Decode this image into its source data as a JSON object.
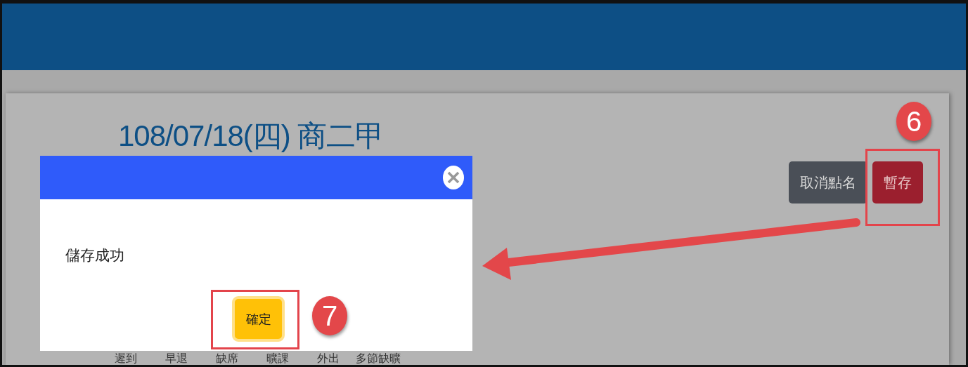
{
  "page_title": "108/07/18(四) 商二甲",
  "actions": [
    {
      "label": "取消點名",
      "kind": "secondary"
    },
    {
      "label": "暫存",
      "kind": "danger"
    }
  ],
  "column_headers": [
    "遲到",
    "早退",
    "缺席",
    "曠課",
    "外出",
    "多節缺曠"
  ],
  "dialog": {
    "message": "儲存成功",
    "confirm_button": "確定"
  },
  "callouts": [
    {
      "number": "6"
    },
    {
      "number": "7"
    }
  ]
}
